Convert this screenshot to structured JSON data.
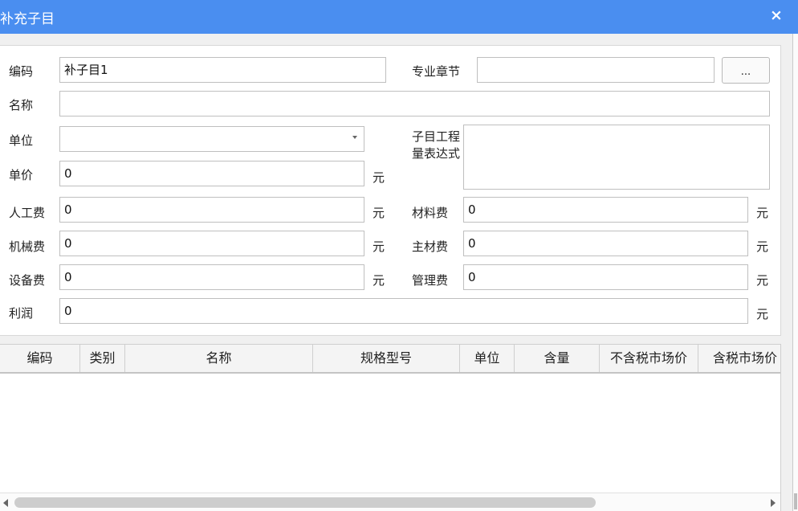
{
  "window": {
    "title": "补充子目",
    "close_glyph": "×"
  },
  "form": {
    "code": {
      "label": "编码",
      "value": "补子目1"
    },
    "chapter": {
      "label": "专业章节",
      "value": "",
      "button_label": "..."
    },
    "name": {
      "label": "名称",
      "value": ""
    },
    "unit": {
      "label": "单位",
      "value": ""
    },
    "quantity_expr": {
      "label": "子目工程量表达式",
      "value": ""
    },
    "unit_price": {
      "label": "单价",
      "value": "0",
      "unit": "元"
    },
    "labor_fee": {
      "label": "人工费",
      "value": "0",
      "unit": "元"
    },
    "material_fee": {
      "label": "材料费",
      "value": "0",
      "unit": "元"
    },
    "machine_fee": {
      "label": "机械费",
      "value": "0",
      "unit": "元"
    },
    "main_material_fee": {
      "label": "主材费",
      "value": "0",
      "unit": "元"
    },
    "equipment_fee": {
      "label": "设备费",
      "value": "0",
      "unit": "元"
    },
    "management_fee": {
      "label": "管理费",
      "value": "0",
      "unit": "元"
    },
    "profit": {
      "label": "利润",
      "value": "0",
      "unit": "元"
    }
  },
  "table": {
    "columns": [
      "编码",
      "类别",
      "名称",
      "规格型号",
      "单位",
      "含量",
      "不含税市场价",
      "含税市场价"
    ],
    "rows": []
  }
}
